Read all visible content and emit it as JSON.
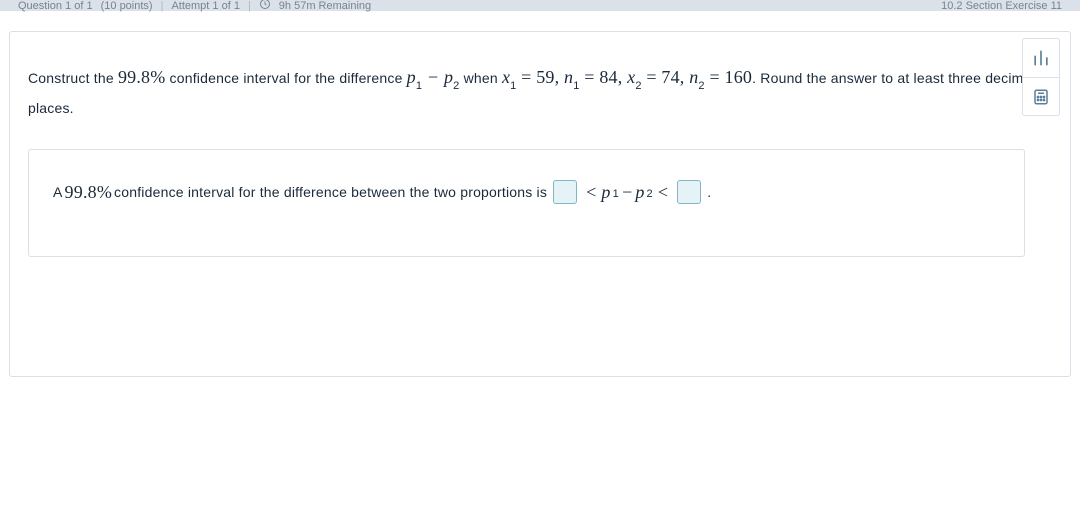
{
  "header": {
    "question_label": "Question 1 of 1",
    "points": "(10 points)",
    "attempt": "Attempt 1 of 1",
    "remaining": "9h 57m Remaining",
    "section_ref": "10.2 Section Exercise 11"
  },
  "question": {
    "prefix": "Construct the ",
    "conf_pct": "99.8%",
    "mid1": " confidence interval for the difference ",
    "p1": "p",
    "p1_sub": "1",
    "minus": " − ",
    "p2": "p",
    "p2_sub": "2",
    "when": " when ",
    "x1": "x",
    "x1_sub": "1",
    "eq1": " = 59,   ",
    "n1": "n",
    "n1_sub": "1",
    "eq2": " = 84,   ",
    "x2": "x",
    "x2_sub": "2",
    "eq3": " = 74,   ",
    "n2": "n",
    "n2_sub": "2",
    "eq4": " = 160",
    "tail": ". Round the answer to at least three decimal places."
  },
  "answer": {
    "prefix": "A ",
    "conf_pct": "99.8%",
    "mid": " confidence interval for the difference between the two proportions is ",
    "lt1": "<",
    "p1": "p",
    "p1_sub": "1",
    "minus": " − ",
    "p2": "p",
    "p2_sub": "2",
    "lt2": "<",
    "period": "."
  }
}
